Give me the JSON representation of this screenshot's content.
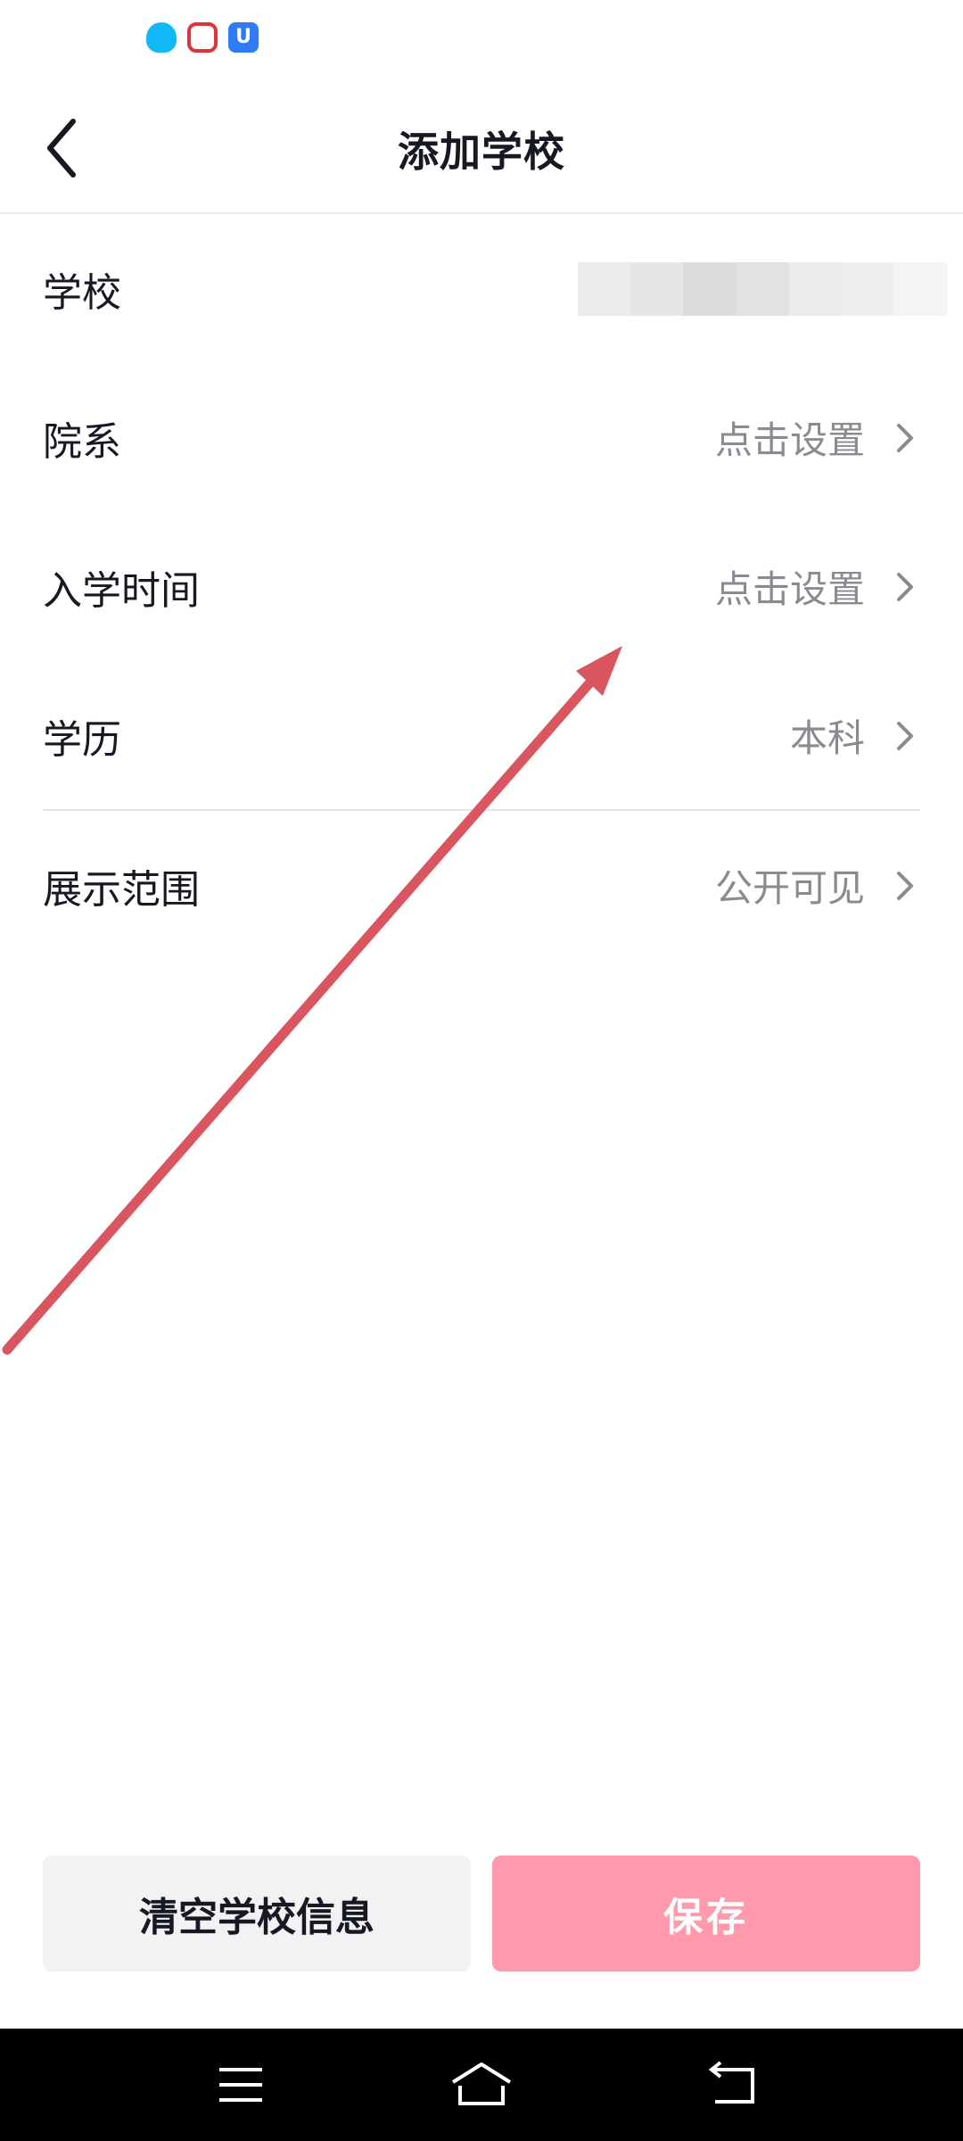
{
  "status_bar": {
    "icons": [
      "qq-icon",
      "baidu-icon",
      "ucloud-icon"
    ]
  },
  "header": {
    "title": "添加学校"
  },
  "form": {
    "rows": [
      {
        "label": "学校",
        "value": ""
      },
      {
        "label": "院系",
        "value": "点击设置"
      },
      {
        "label": "入学时间",
        "value": "点击设置"
      },
      {
        "label": "学历",
        "value": "本科"
      },
      {
        "label": "展示范围",
        "value": "公开可见"
      }
    ]
  },
  "actions": {
    "clear_label": "清空学校信息",
    "save_label": "保存"
  },
  "colors": {
    "save_button": "#ff99ab",
    "clear_button": "#f2f2f3",
    "annotation_arrow": "#d9555f",
    "nav_bar": "#000000"
  }
}
